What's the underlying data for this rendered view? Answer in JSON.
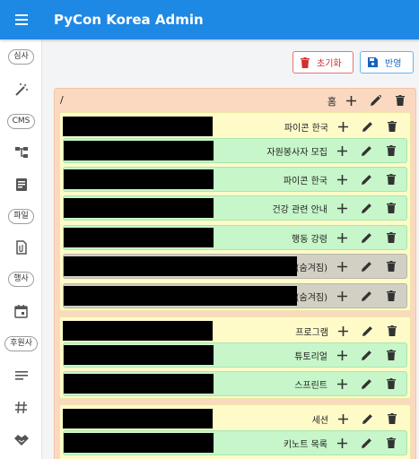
{
  "app": {
    "title": "PyCon Korea Admin"
  },
  "sidebar": {
    "chips": {
      "review": "심사",
      "cms": "CMS",
      "files": "파일",
      "events": "행사",
      "sponsors": "후원사"
    }
  },
  "toolbar": {
    "reset_label": "초기화",
    "apply_label": "반영"
  },
  "tree": {
    "root": {
      "path": "/",
      "label": "홈"
    },
    "groups": [
      {
        "label": "파이콘 한국",
        "children": [
          {
            "label": "자원봉사자 모집"
          },
          {
            "label": "파이콘 한국"
          },
          {
            "label": "건강 관련 안내"
          },
          {
            "label": "행동 강령"
          },
          {
            "label": "(숨겨짐)"
          },
          {
            "label": "(숨겨짐)"
          }
        ]
      },
      {
        "label": "프로그램",
        "children": [
          {
            "label": "튜토리얼"
          },
          {
            "label": "스프린트"
          }
        ]
      },
      {
        "label": "세션",
        "children": [
          {
            "label": "키노트 목록"
          }
        ]
      }
    ]
  },
  "colors": {
    "appbar": "#1e88e5",
    "root_bg": "#fbd9c1",
    "group_bg": "#fefbc9",
    "child_bg": "#c6f6c9",
    "hidden_bg": "#d2d0c4",
    "reset": "#d32f2f",
    "apply": "#1565c0"
  },
  "icons": [
    "menu-icon",
    "magic-wand-icon",
    "sitemap-icon",
    "document-icon",
    "attachment-icon",
    "calendar-icon",
    "notes-icon",
    "hashtag-icon",
    "handshake-icon",
    "plus-icon",
    "pencil-icon",
    "trash-icon",
    "save-icon"
  ]
}
